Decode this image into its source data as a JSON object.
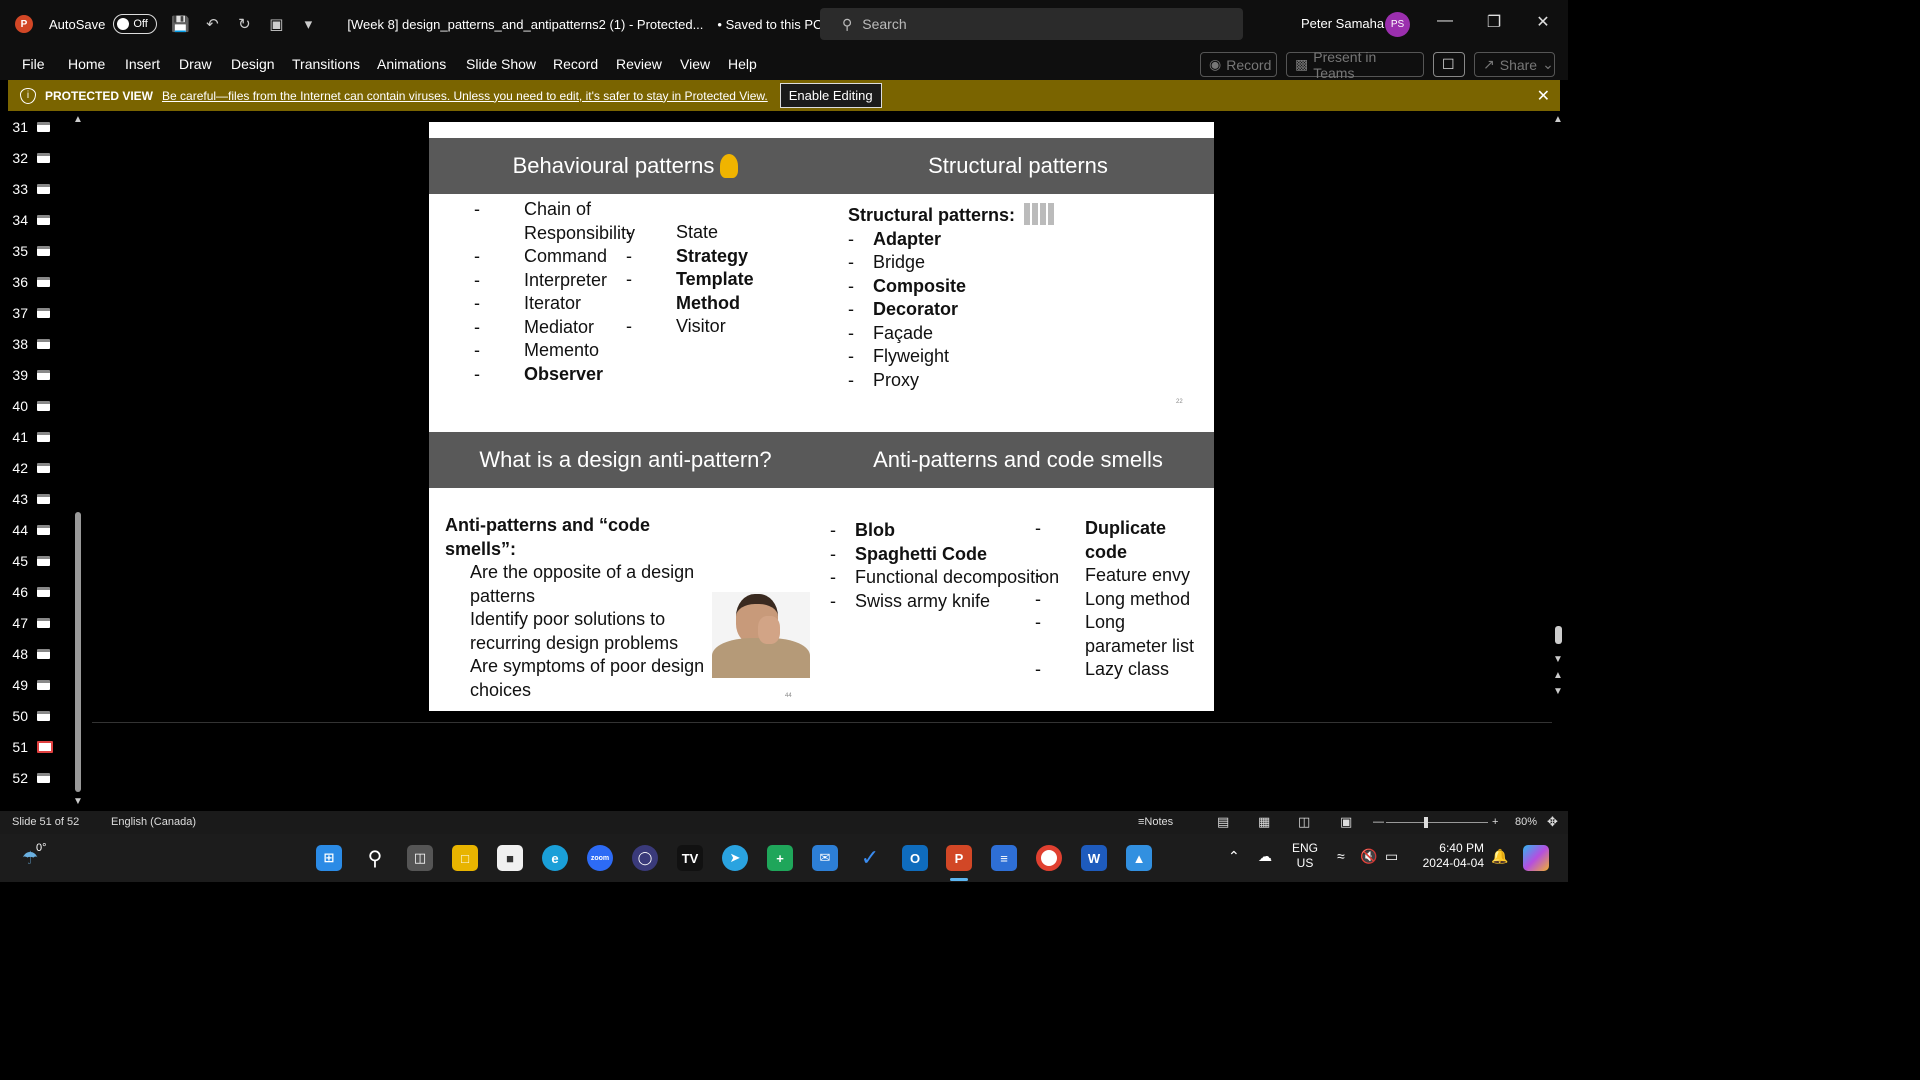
{
  "titlebar": {
    "autosave_label": "AutoSave",
    "autosave_state": "Off",
    "doc_title": "[Week 8] design_patterns_and_antipatterns2 (1)  -  Protected...",
    "saved_status": "• Saved to this PC",
    "search_placeholder": "Search",
    "user_name": "Peter Samaha",
    "user_initials": "PS"
  },
  "menu": {
    "items": [
      "File",
      "Home",
      "Insert",
      "Draw",
      "Design",
      "Transitions",
      "Animations",
      "Slide Show",
      "Record",
      "Review",
      "View",
      "Help"
    ],
    "record_label": "Record",
    "present_label": "Present in Teams",
    "share_label": "Share"
  },
  "protected_view": {
    "title": "PROTECTED VIEW",
    "message": "Be careful—files from the Internet can contain viruses. Unless you need to edit, it's safer to stay in Protected View.",
    "button": "Enable Editing"
  },
  "thumbnails": {
    "numbers": [
      "31",
      "32",
      "33",
      "34",
      "35",
      "36",
      "37",
      "38",
      "39",
      "40",
      "41",
      "42",
      "43",
      "44",
      "45",
      "46",
      "47",
      "48",
      "49",
      "50",
      "51",
      "52"
    ],
    "selected": "51"
  },
  "slide": {
    "q1_title": "Behavioural patterns",
    "q1_col1": [
      "Chain of Responsibility",
      "Command",
      "Interpreter",
      "Iterator",
      "Mediator",
      "Memento",
      "Observer"
    ],
    "q1_col2": [
      "State",
      "Strategy",
      "Template Method",
      "Visitor"
    ],
    "q2_title": "Structural patterns",
    "q2_heading": "Structural patterns:",
    "q2_items": [
      "Adapter",
      "Bridge",
      "Composite",
      "Decorator",
      "Façade",
      "Flyweight",
      "Proxy"
    ],
    "q2_page": "22",
    "q3_title": "What is a design anti-pattern?",
    "q3_heading": "Anti-patterns and “code smells”:",
    "q3_items": [
      "Are the opposite of a design patterns",
      "Identify poor solutions to recurring design problems",
      "Are symptoms of poor design choices"
    ],
    "q3_page": "44",
    "q4_title": "Anti-patterns and code smells",
    "q4_col1": [
      "Blob",
      "Spaghetti Code",
      "Functional decomposition",
      "Swiss army knife"
    ],
    "q4_col2": [
      "Duplicate code",
      "Feature envy",
      "Long method",
      "Long parameter list",
      "Lazy class"
    ]
  },
  "status": {
    "slide_counter": "Slide 51 of 52",
    "language": "English (Canada)",
    "notes": "Notes",
    "zoom": "80%"
  },
  "taskbar": {
    "weather": "0°",
    "lang1": "ENG",
    "lang2": "US",
    "time": "6:40 PM",
    "date": "2024-04-04"
  },
  "colors": {
    "ppt_red": "#d24726",
    "protected_bar": "#7a6400",
    "header_grey": "#595959",
    "avatar": "#9b2fae"
  }
}
